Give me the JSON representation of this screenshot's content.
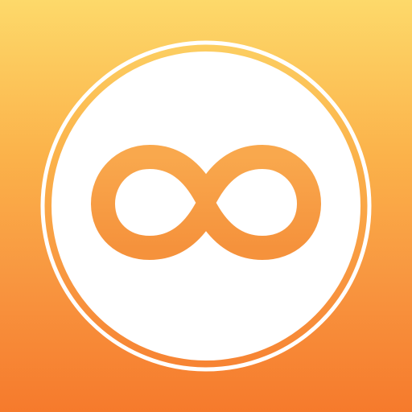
{
  "icon": {
    "symbol": "infinity-icon",
    "colors": {
      "gradient_top": "#FDD96A",
      "gradient_upper_mid": "#FBB24A",
      "gradient_lower_mid": "#F89640",
      "gradient_bottom": "#F67A2C",
      "ring": "#FFFFFF",
      "disc": "#FFFFFF",
      "symbol_light": "#F9A84D",
      "symbol_dark": "#F5923C"
    }
  }
}
